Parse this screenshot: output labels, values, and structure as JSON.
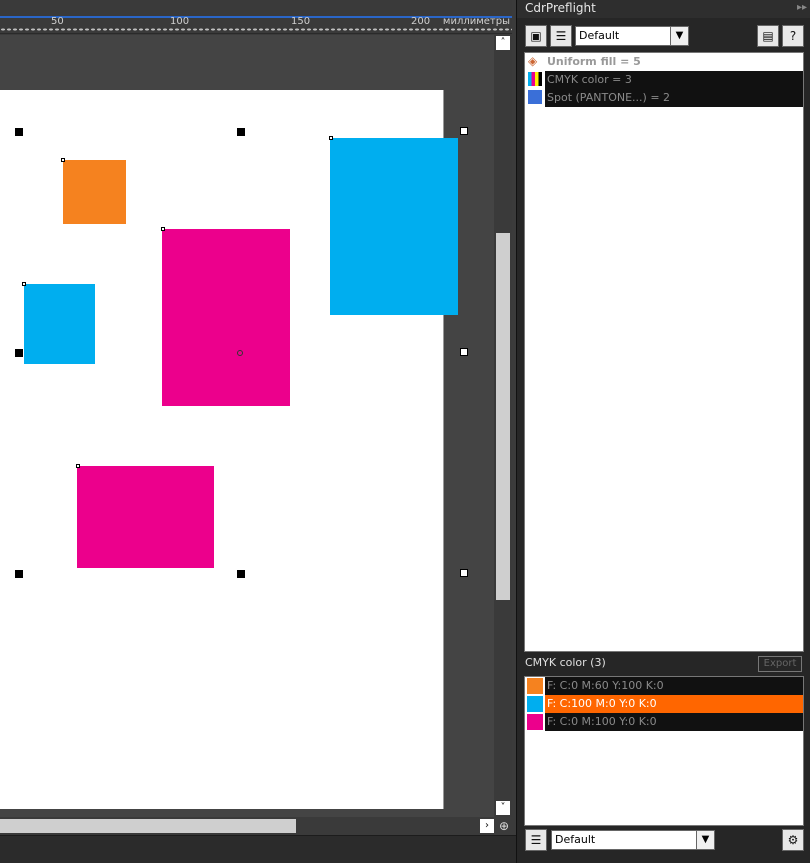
{
  "ruler": {
    "labels": [
      "50",
      "100",
      "150",
      "200"
    ],
    "unit": "миллиметры"
  },
  "docker": {
    "title": "CdrPreflight",
    "more_glyph": "▸▸",
    "profile_value": "Default",
    "tree": [
      {
        "label": "Uniform fill = 5",
        "icon": "fill-bucket-icon"
      },
      {
        "label": "CMYK color = 3",
        "icon": "cmyk-icon"
      },
      {
        "label": "Spot (PANTONE...) = 2",
        "icon": "spot-color-icon"
      }
    ],
    "sub_title": "CMYK color (3)",
    "export_label": "Export",
    "swatches": [
      {
        "label": "F: C:0 M:60 Y:100 K:0",
        "color": "#f5821f"
      },
      {
        "label": "F: C:100 M:0 Y:0 K:0",
        "color": "#00aeef"
      },
      {
        "label": "F: C:0 M:100 Y:0 K:0",
        "color": "#ec008c"
      }
    ],
    "bottom_profile_value": "Default"
  },
  "colors": {
    "orange": "#f5821f",
    "cyan": "#00aeef",
    "magenta": "#ec008c",
    "selection": "#ff6600",
    "ruler_accent": "#2a66c8"
  }
}
